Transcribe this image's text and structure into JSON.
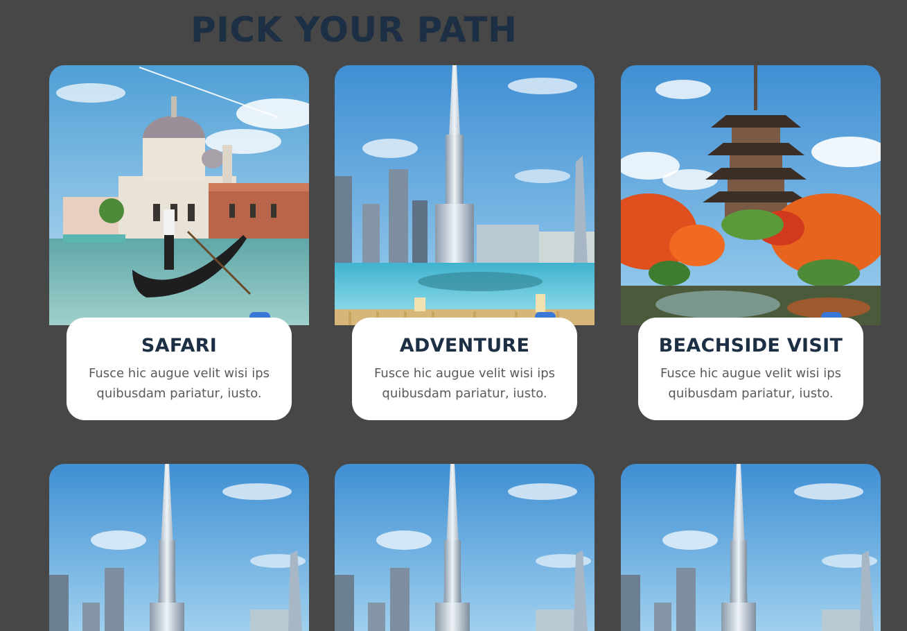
{
  "section": {
    "title": "PICK YOUR PATH"
  },
  "cards": [
    {
      "title": "SAFARI",
      "text": "Fusce hic augue velit wisi ips quibusdam pariatur, iusto."
    },
    {
      "title": "ADVENTURE",
      "text": "Fusce hic augue velit wisi ips quibusdam pariatur, iusto."
    },
    {
      "title": "BEACHSIDE VISIT",
      "text": "Fusce hic augue velit wisi ips quibusdam pariatur, iusto."
    }
  ],
  "colors": {
    "background": "#474747",
    "title": "#1c2f44",
    "accent": "#3a78d8",
    "card": "#ffffff"
  }
}
